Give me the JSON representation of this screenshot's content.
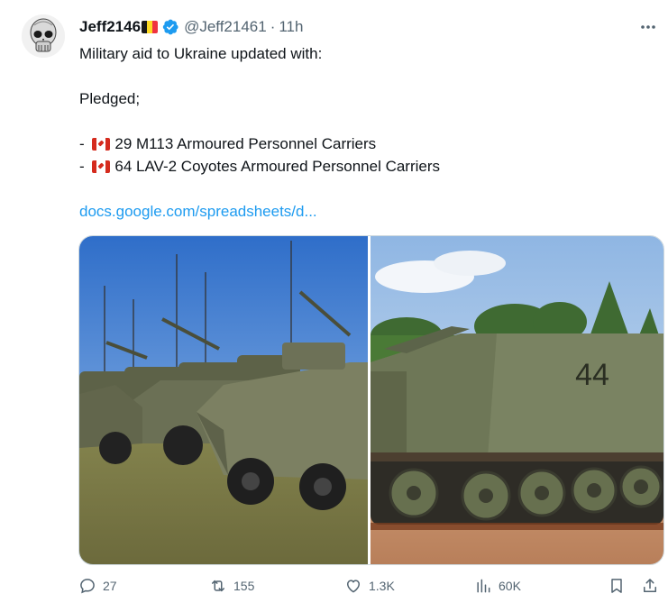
{
  "tweet": {
    "author": {
      "name": "Jeff2146",
      "handle": "@Jeff21461",
      "time": "11h",
      "verified": true,
      "flag": "belgium-flag-emoji"
    },
    "text": {
      "line1": "Military aid to Ukraine updated with:",
      "line2": "Pledged;",
      "item1_prefix": "- ",
      "item1": "29 M113 Armoured Personnel Carriers",
      "item2_prefix": "- ",
      "item2": "64 LAV-2 Coyotes Armoured Personnel Carriers",
      "item_flag": "canada-flag-emoji",
      "link": "docs.google.com/spreadsheets/d..."
    },
    "media": {
      "images": [
        {
          "subject": "LAV-2 Coyote armoured vehicles in a field"
        },
        {
          "subject": "M113 armoured personnel carrier number 44"
        }
      ],
      "image2_marking": "44"
    },
    "actions": {
      "replies": "27",
      "reposts": "155",
      "likes": "1.3K",
      "views": "60K"
    }
  },
  "colors": {
    "accent": "#1d9bf0",
    "text": "#0f1419",
    "secondary": "#536471",
    "border": "#cfd9de"
  },
  "icons": [
    "skull-avatar",
    "verified-badge-icon",
    "more-icon",
    "reply-icon",
    "repost-icon",
    "like-icon",
    "views-icon",
    "bookmark-icon",
    "share-icon"
  ]
}
